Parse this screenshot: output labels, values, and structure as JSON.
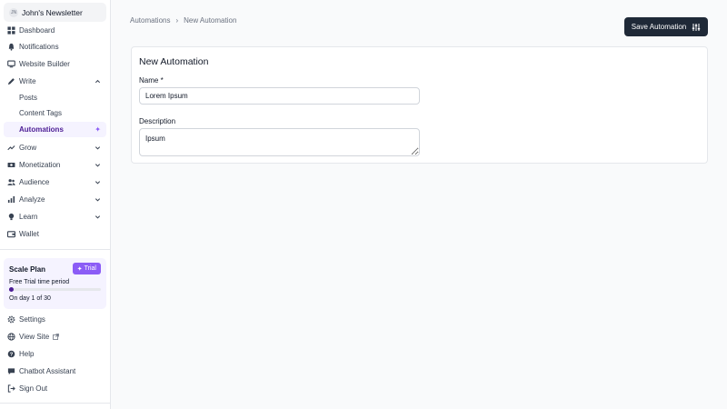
{
  "app": {
    "newsletter_name": "John's Newsletter",
    "avatar_initial": "JN"
  },
  "sidebar": {
    "items": [
      {
        "label": "Dashboard",
        "icon": "grid-icon"
      },
      {
        "label": "Notifications",
        "icon": "bell-icon"
      },
      {
        "label": "Website Builder",
        "icon": "monitor-icon"
      },
      {
        "label": "Write",
        "icon": "pen-icon",
        "expanded": true
      },
      {
        "label": "Posts"
      },
      {
        "label": "Content Tags"
      },
      {
        "label": "Automations",
        "active": true
      },
      {
        "label": "Grow",
        "icon": "trend-icon"
      },
      {
        "label": "Monetization",
        "icon": "money-icon"
      },
      {
        "label": "Audience",
        "icon": "users-icon"
      },
      {
        "label": "Analyze",
        "icon": "bar-chart-icon"
      },
      {
        "label": "Learn",
        "icon": "bulb-icon"
      },
      {
        "label": "Wallet",
        "icon": "wallet-icon"
      }
    ],
    "footer_items": [
      {
        "label": "Settings",
        "icon": "gear-icon"
      },
      {
        "label": "View Site",
        "icon": "globe-icon"
      },
      {
        "label": "Help",
        "icon": "help-icon"
      },
      {
        "label": "Chatbot Assistant",
        "icon": "chat-icon"
      },
      {
        "label": "Sign Out",
        "icon": "sign-out-icon"
      }
    ]
  },
  "plan": {
    "title": "Scale Plan",
    "badge": "Trial",
    "subtitle": "Free Trial time period",
    "day_text": "On day 1 of 30",
    "progress_fraction": 0.033
  },
  "header": {
    "breadcrumb": [
      "Automations",
      "New Automation"
    ],
    "save_label": "Save Automation"
  },
  "form": {
    "title": "New Automation",
    "name_label": "Name *",
    "name_value": "Lorem Ipsum",
    "description_label": "Description",
    "description_value": "Ipsum"
  },
  "colors": {
    "accent": "#8b5cf6",
    "active_text": "#4c1d95",
    "button_bg": "#1f2937"
  }
}
